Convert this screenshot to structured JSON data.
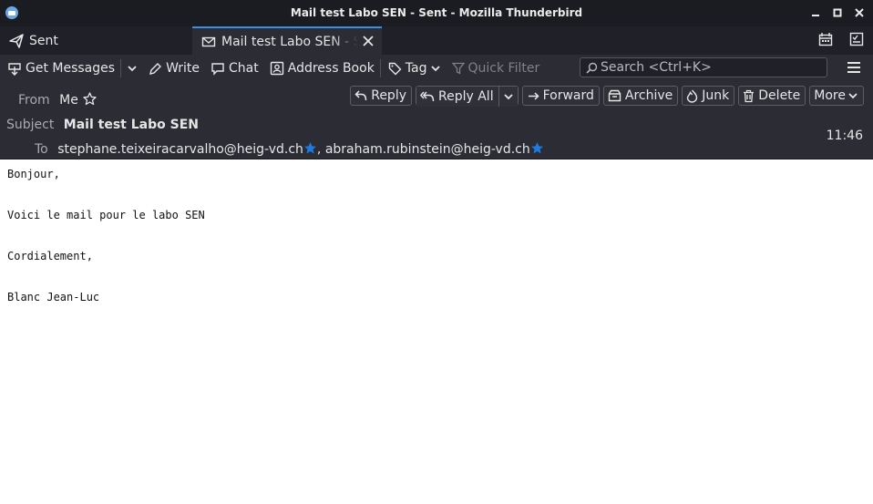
{
  "window": {
    "title": "Mail test Labo SEN - Sent - Mozilla Thunderbird",
    "controls": [
      "minimize",
      "maximize",
      "close"
    ]
  },
  "tabs": [
    {
      "label": "Sent",
      "icon": "send-icon"
    },
    {
      "label": "Mail test Labo SEN - Sent",
      "icon": "envelope-icon"
    }
  ],
  "toolbar": {
    "get_messages": "Get Messages",
    "write": "Write",
    "chat": "Chat",
    "address_book": "Address Book",
    "tag": "Tag",
    "quick_filter": "Quick Filter",
    "search_placeholder": "Search <Ctrl+K>"
  },
  "header": {
    "from_label": "From",
    "from_value": "Me",
    "subject_label": "Subject",
    "subject_value": "Mail test Labo SEN",
    "to_label": "To",
    "to_1": "stephane.teixeiracarvalho@heig-vd.ch",
    "to_separator": ",",
    "to_2": "abraham.rubinstein@heig-vd.ch",
    "time": "11:46"
  },
  "actions": {
    "reply": "Reply",
    "reply_all": "Reply All",
    "forward": "Forward",
    "archive": "Archive",
    "junk": "Junk",
    "delete": "Delete",
    "more": "More"
  },
  "message_body": {
    "line1": "Bonjour,",
    "line2": "Voici le mail pour le labo SEN",
    "line3": "Cordialement,",
    "line4": "Blanc Jean-Luc"
  },
  "colors": {
    "accent": "#3a8ee6",
    "star": "#1f7ae0",
    "chrome_dark": "#1b1c22",
    "chrome": "#2b2c34"
  }
}
